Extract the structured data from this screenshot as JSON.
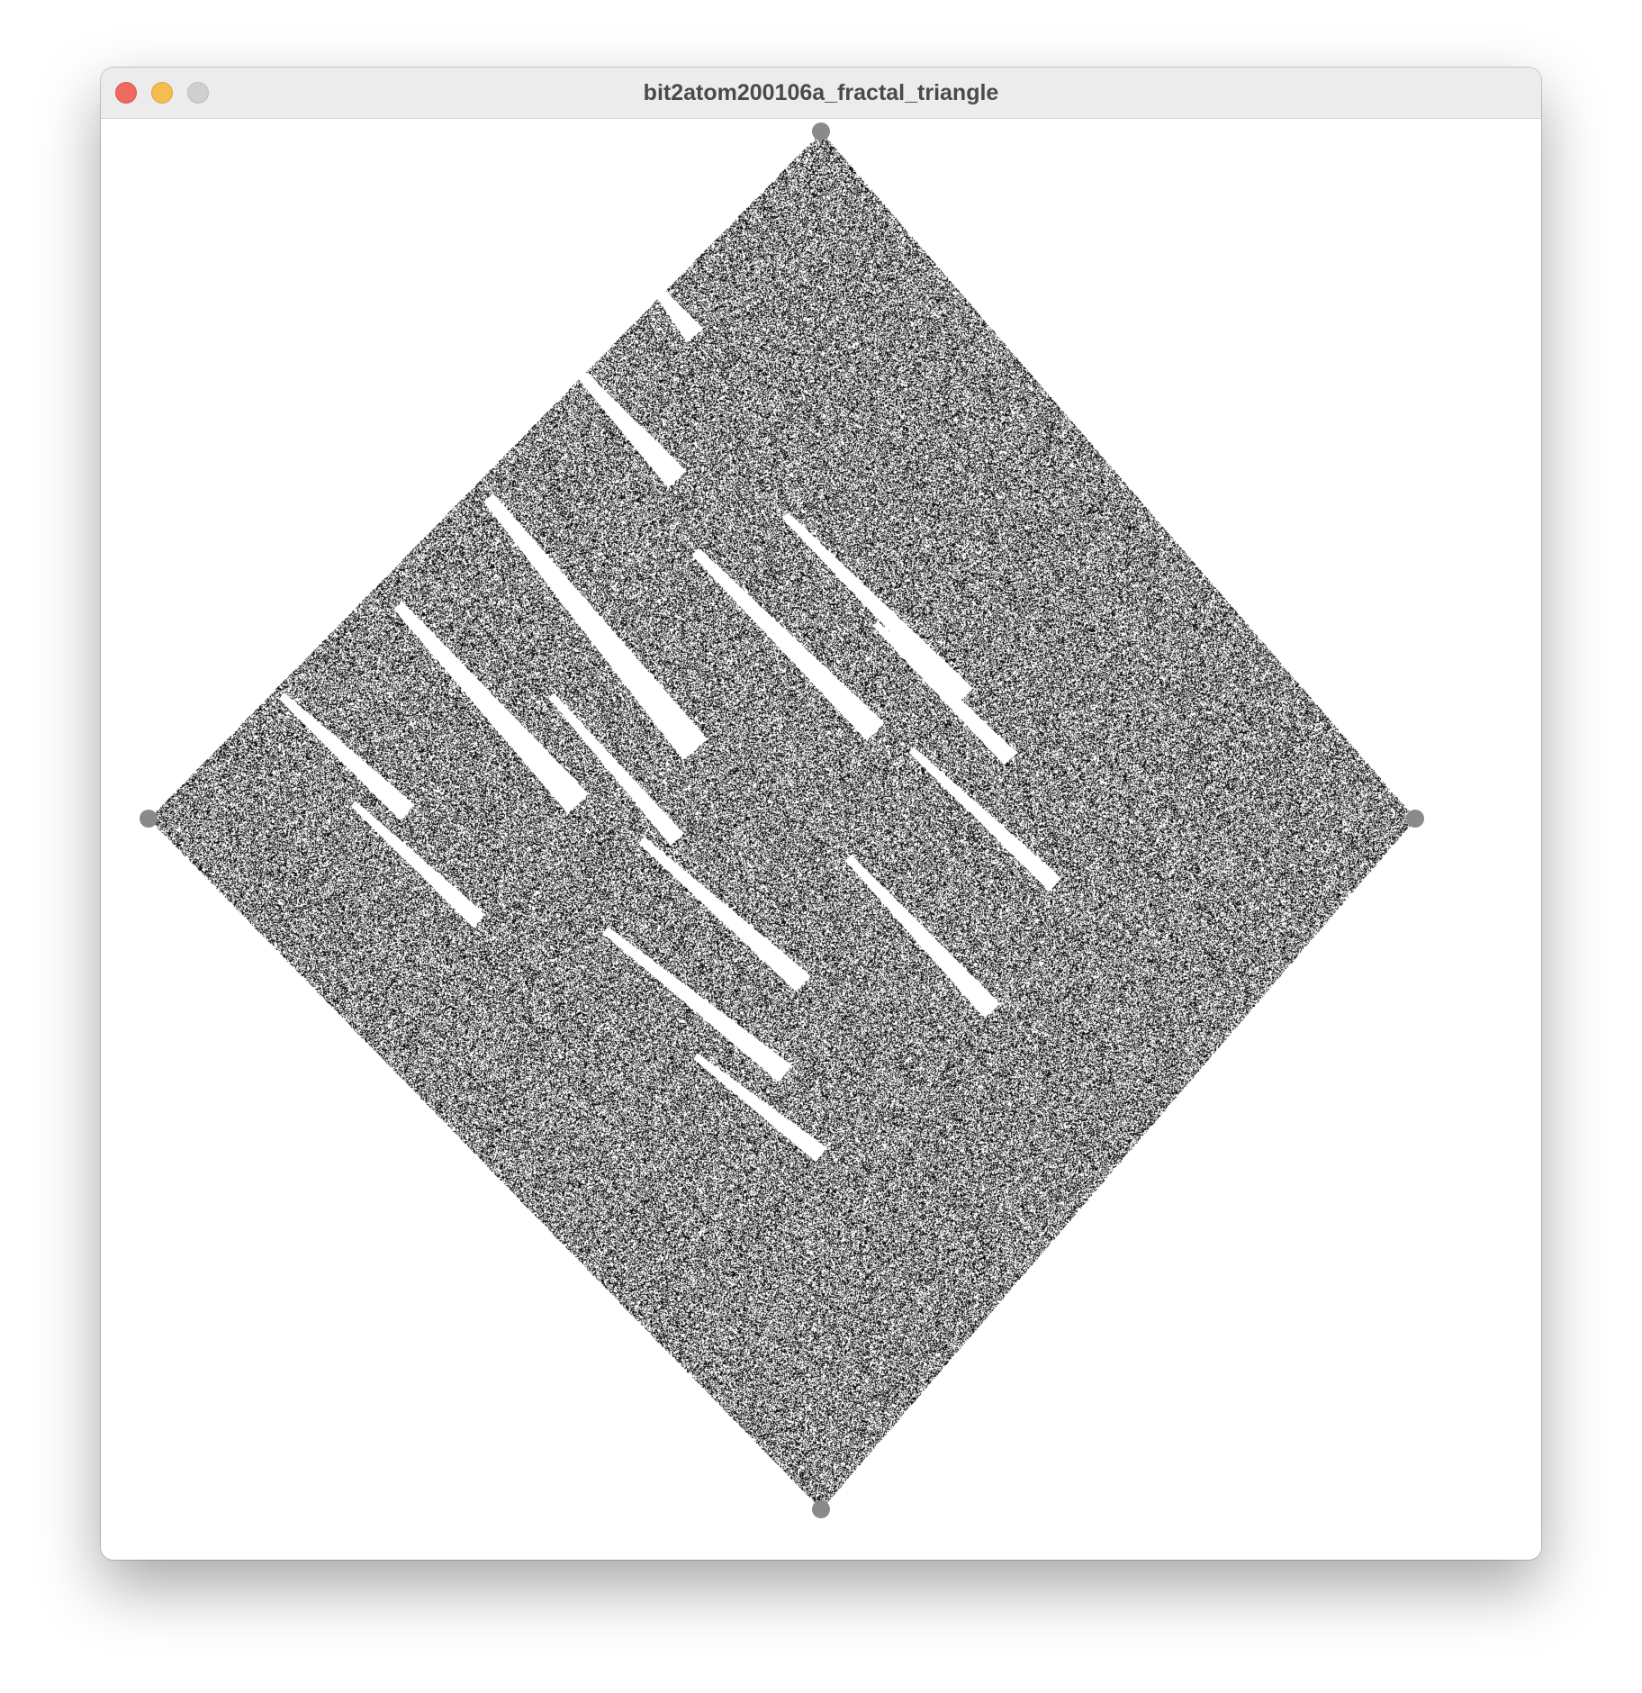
{
  "window": {
    "title": "bit2atom200106a_fractal_triangle"
  },
  "colors": {
    "point": "#000000",
    "vertex": "#8a8a8a",
    "background": "#ffffff"
  },
  "icons": {
    "close": "close-icon",
    "minimize": "minimize-icon",
    "zoom": "zoom-icon"
  }
}
